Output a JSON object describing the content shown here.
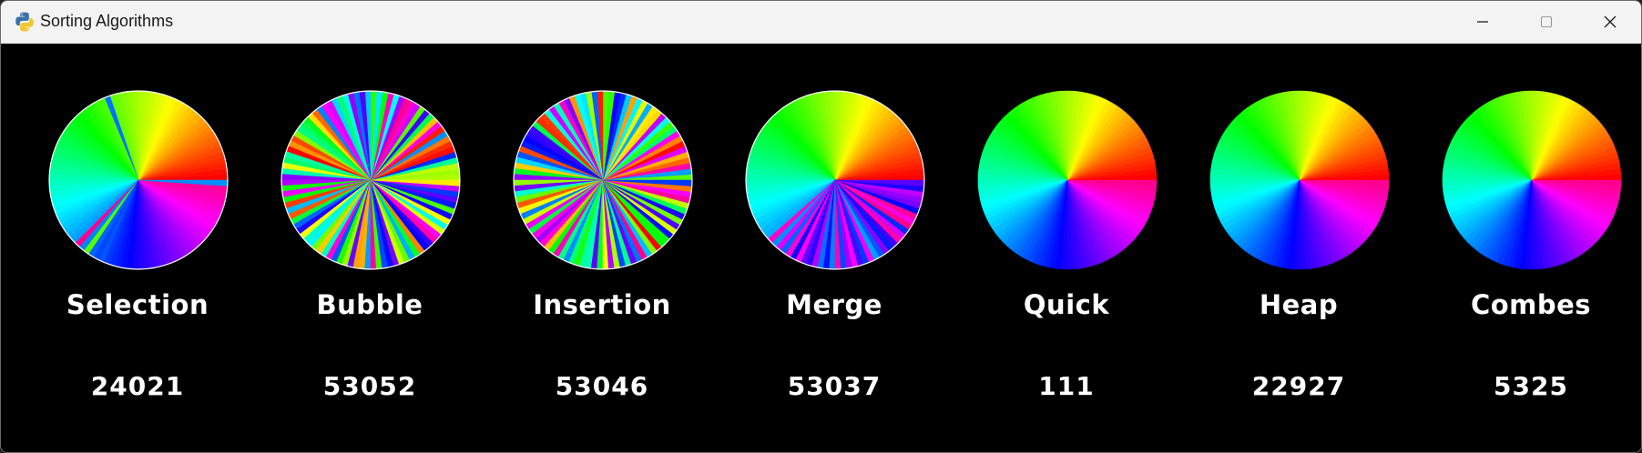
{
  "window": {
    "title": "Sorting Algorithms",
    "background": "#000000"
  },
  "panels": [
    {
      "name": "Selection",
      "count": "24021",
      "state": "mostly-sorted"
    },
    {
      "name": "Bubble",
      "count": "53052",
      "state": "scrambled"
    },
    {
      "name": "Insertion",
      "count": "53046",
      "state": "scrambled"
    },
    {
      "name": "Merge",
      "count": "53037",
      "state": "partially-sorted"
    },
    {
      "name": "Quick",
      "count": "111",
      "state": "sorted"
    },
    {
      "name": "Heap",
      "count": "22927",
      "state": "sorted"
    },
    {
      "name": "Combes",
      "count": "5325",
      "state": "sorted"
    }
  ],
  "icons": {
    "app": "python-icon",
    "minimize": "minimize-icon",
    "maximize": "maximize-icon",
    "close": "close-icon"
  }
}
